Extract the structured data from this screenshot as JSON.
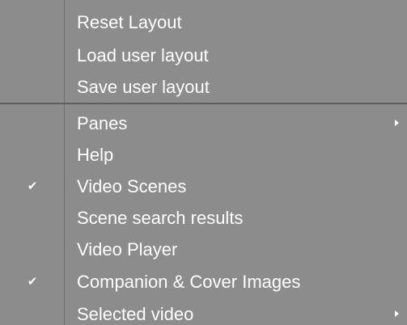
{
  "menu": {
    "group1": [
      {
        "label": "Reset Layout",
        "checked": false,
        "submenu": false
      },
      {
        "label": "Load user layout",
        "checked": false,
        "submenu": false
      },
      {
        "label": "Save user layout",
        "checked": false,
        "submenu": false
      }
    ],
    "group2": [
      {
        "label": "Panes",
        "checked": false,
        "submenu": true
      },
      {
        "label": "Help",
        "checked": false,
        "submenu": false
      },
      {
        "label": "Video Scenes",
        "checked": true,
        "submenu": false
      },
      {
        "label": "Scene search results",
        "checked": false,
        "submenu": false
      },
      {
        "label": "Video Player",
        "checked": false,
        "submenu": false
      },
      {
        "label": "Companion & Cover Images",
        "checked": true,
        "submenu": false
      },
      {
        "label": "Selected video",
        "checked": false,
        "submenu": true
      }
    ],
    "check_glyph": "✔",
    "colors": {
      "background": "#8c8c8c",
      "text": "#ffffff",
      "separator": "#5f5f5f"
    }
  }
}
